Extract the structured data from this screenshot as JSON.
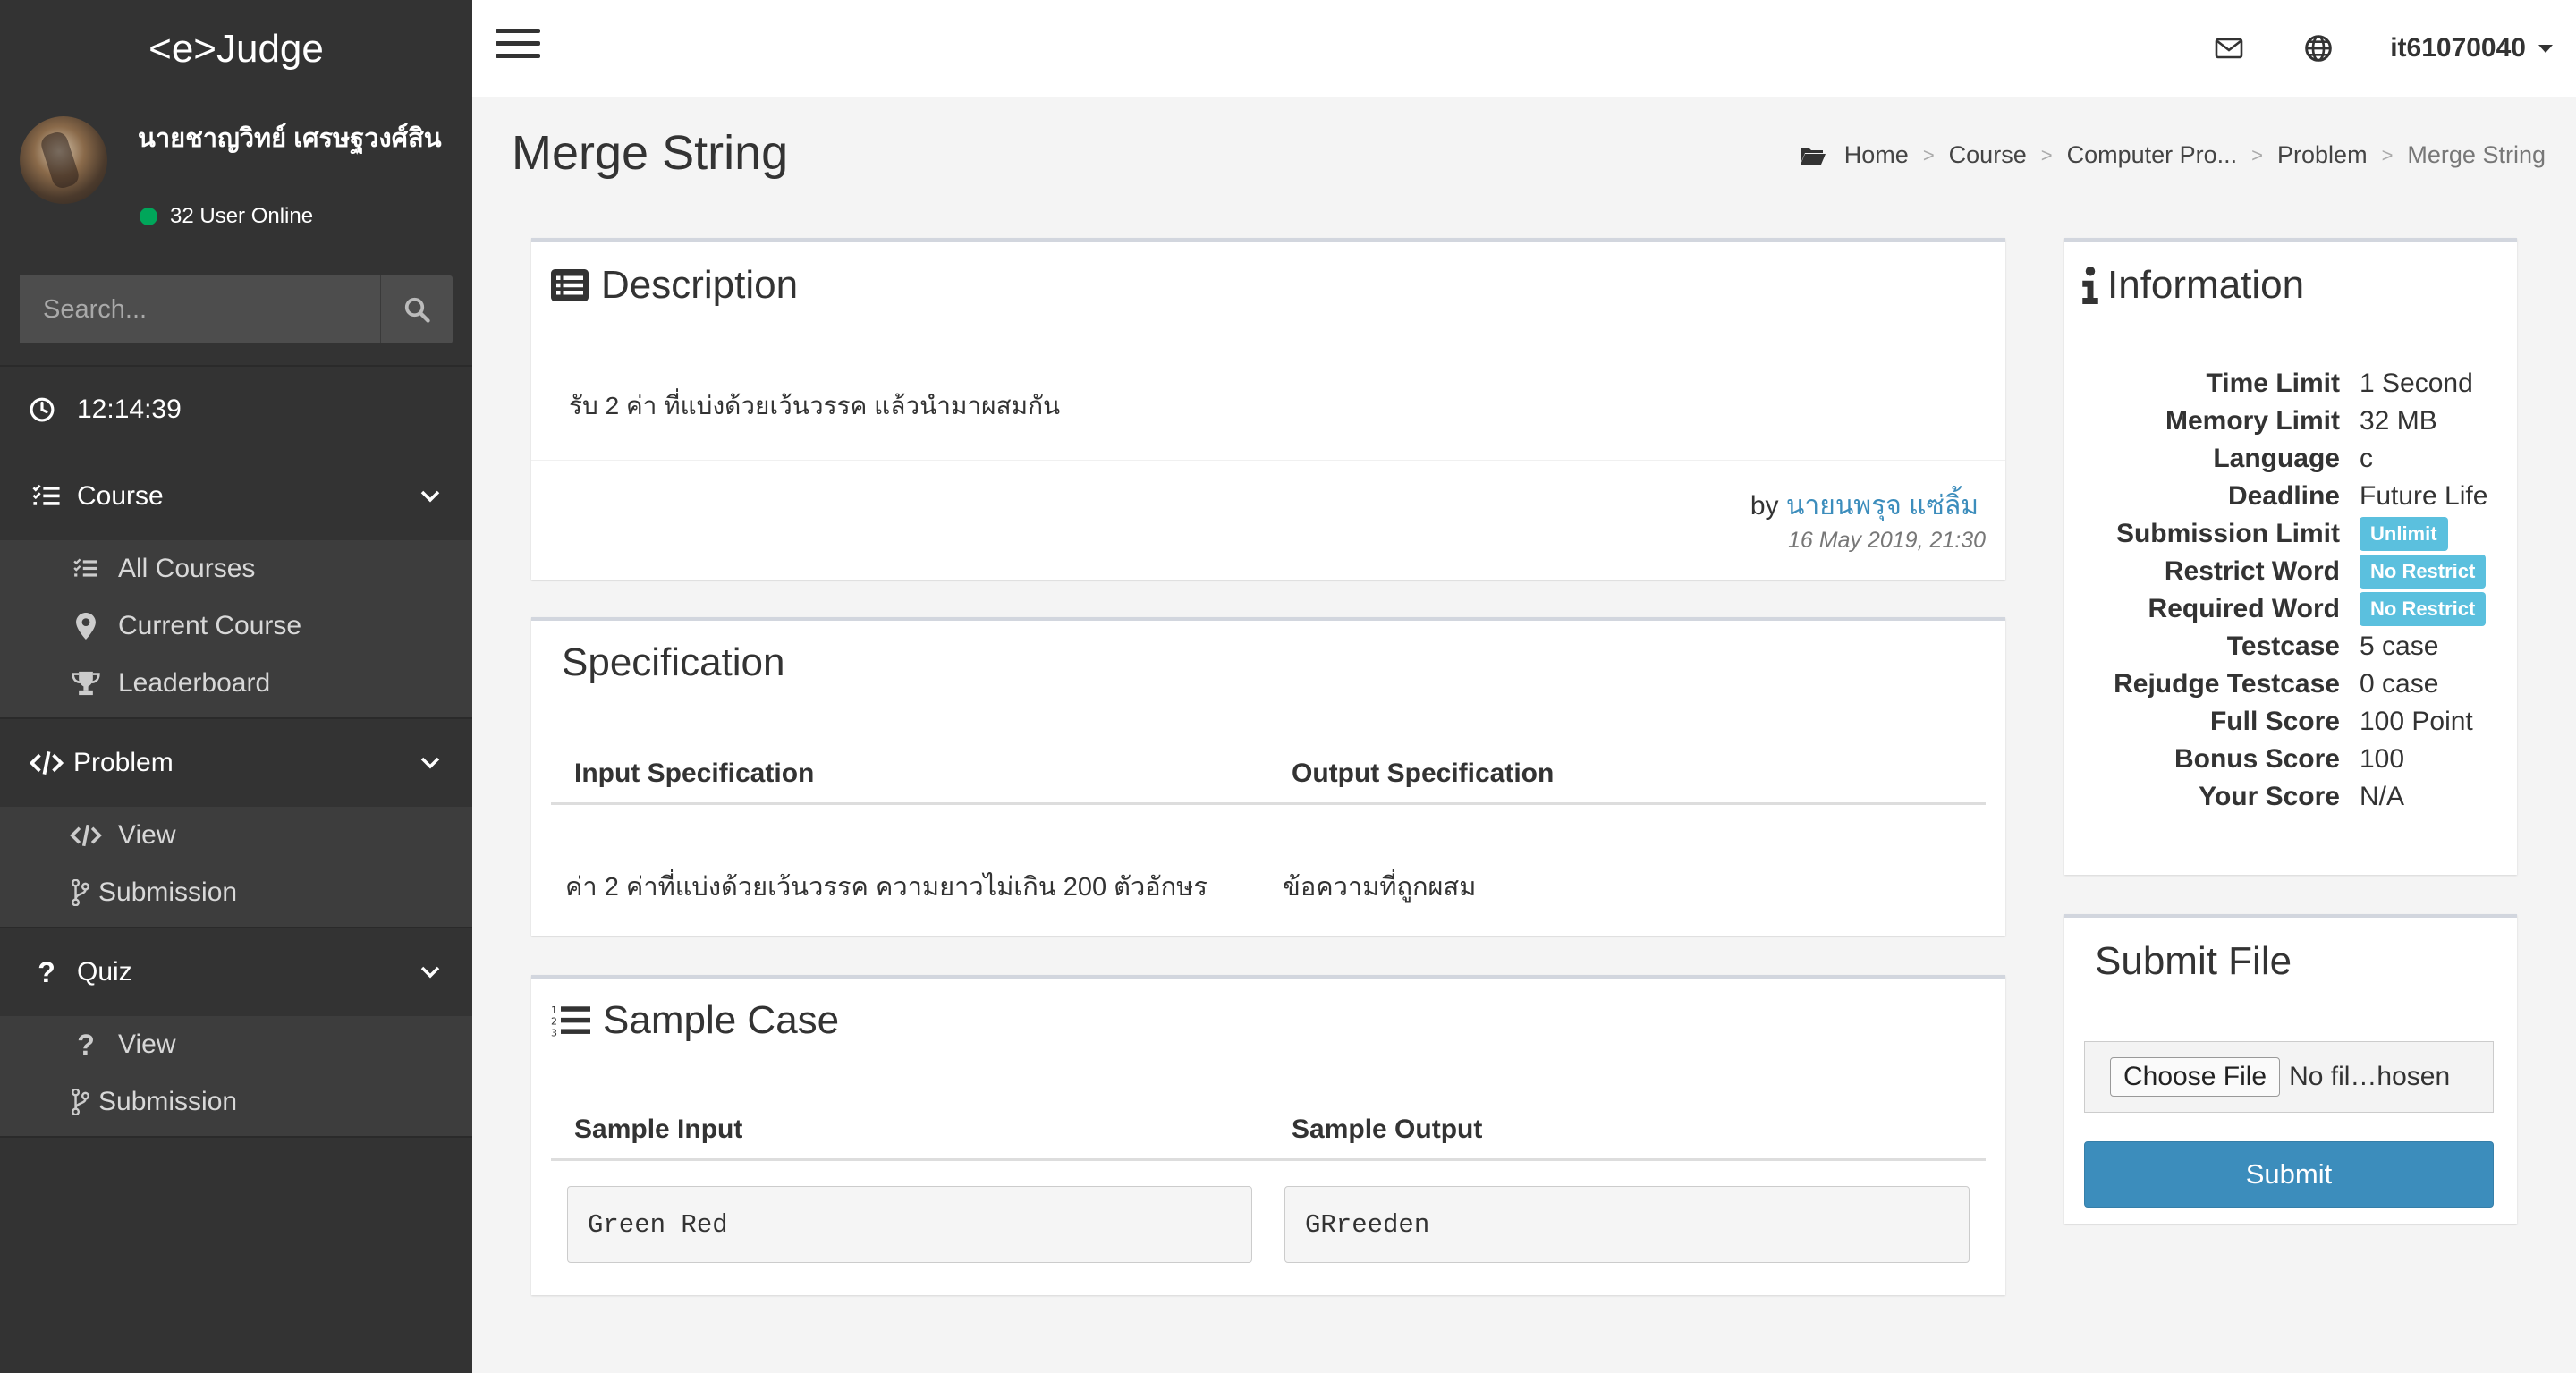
{
  "app": {
    "brand": "<e>Judge"
  },
  "user_panel": {
    "name": "นายชาญวิทย์ เศรษฐวงศ์สิน",
    "online_text": "32 User Online"
  },
  "search": {
    "placeholder": "Search..."
  },
  "clock": {
    "time": "12:14:39"
  },
  "menu": {
    "course": {
      "label": "Course",
      "items": [
        "All Courses",
        "Current Course",
        "Leaderboard"
      ]
    },
    "problem": {
      "label": "Problem",
      "items": [
        "View",
        "Submission"
      ]
    },
    "quiz": {
      "label": "Quiz",
      "items": [
        "View",
        "Submission"
      ]
    }
  },
  "topbar": {
    "username": "it61070040"
  },
  "page": {
    "title": "Merge String",
    "breadcrumb": [
      "Home",
      "Course",
      "Computer Pro...",
      "Problem",
      "Merge String"
    ]
  },
  "description": {
    "title": "Description",
    "text": "รับ 2 ค่า ที่แบ่งด้วยเว้นวรรค แล้วนำมาผสมกัน",
    "by_prefix": "by",
    "author": "นายนพรุจ แซ่ลิ้ม",
    "date": "16 May 2019, 21:30"
  },
  "specification": {
    "title": "Specification",
    "input_header": "Input Specification",
    "output_header": "Output Specification",
    "input_text": "ค่า 2 ค่าที่แบ่งด้วยเว้นวรรค ความยาวไม่เกิน 200 ตัวอักษร",
    "output_text": "ข้อความที่ถูกผสม"
  },
  "sample": {
    "title": "Sample Case",
    "input_header": "Sample Input",
    "output_header": "Sample Output",
    "input": "Green Red",
    "output": "GRreeden"
  },
  "information": {
    "title": "Information",
    "rows": [
      {
        "label": "Time Limit",
        "value": "1 Second"
      },
      {
        "label": "Memory Limit",
        "value": "32 MB"
      },
      {
        "label": "Language",
        "value": "c"
      },
      {
        "label": "Deadline",
        "value": "Future Life"
      },
      {
        "label": "Submission Limit",
        "value": "Unlimit",
        "badge": true
      },
      {
        "label": "Restrict Word",
        "value": "No Restrict",
        "badge": true
      },
      {
        "label": "Required Word",
        "value": "No Restrict",
        "badge": true
      },
      {
        "label": "Testcase",
        "value": "5 case"
      },
      {
        "label": "Rejudge Testcase",
        "value": "0 case"
      },
      {
        "label": "Full Score",
        "value": "100 Point"
      },
      {
        "label": "Bonus Score",
        "value": "100"
      },
      {
        "label": "Your Score",
        "value": "N/A"
      }
    ]
  },
  "submit": {
    "title": "Submit File",
    "choose_label": "Choose File",
    "file_status": "No fil…hosen",
    "button": "Submit"
  },
  "colors": {
    "sidebar": "#333333",
    "accent": "#3c8dbc",
    "badge": "#5bc0de",
    "online": "#00a65a"
  },
  "icons": [
    "search-icon",
    "clock-icon",
    "course-list-icon",
    "code-icon",
    "question-icon",
    "chevron-down-icon",
    "mail-icon",
    "globe-icon",
    "folder-icon",
    "list-alt-icon",
    "info-icon",
    "list-ol-icon",
    "branch-icon",
    "map-marker-icon",
    "trophy-icon"
  ]
}
